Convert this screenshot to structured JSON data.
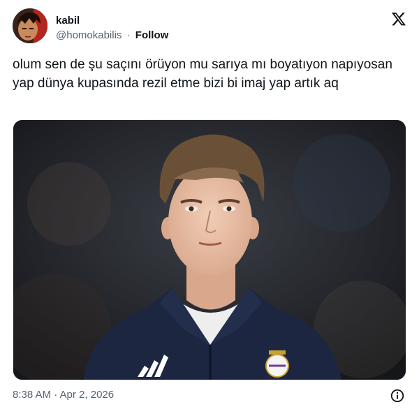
{
  "user": {
    "name": "kabil",
    "handle": "@homokabilis",
    "separator": "·",
    "follow_label": "Follow"
  },
  "tweet": {
    "text": "olum sen de şu saçını örüyon mu sarıya mı boyatıyon napıyosan yap dünya kupasında rezil etme bizi bi imaj yap artık aq"
  },
  "media": {
    "icon": "photo-player-portrait"
  },
  "footer": {
    "timestamp": "8:38 AM · Apr 2, 2026",
    "info_icon": "info-circle-icon"
  },
  "colors": {
    "text": "#0f1419",
    "muted": "#536471",
    "jacket": "#1c2640"
  }
}
